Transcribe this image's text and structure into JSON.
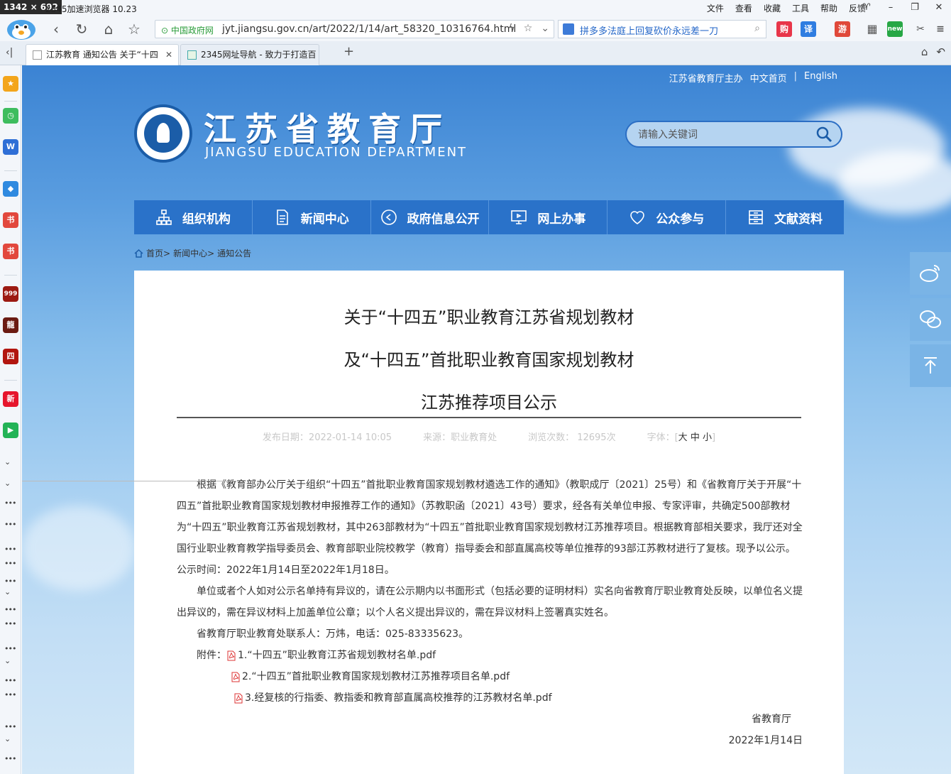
{
  "browser": {
    "dims_badge": "1342 × 692",
    "window_title": "2345加速浏览器 10.23",
    "menu": [
      "文件",
      "查看",
      "收藏",
      "工具",
      "帮助",
      "反馈"
    ],
    "secure_label": "中国政府网",
    "url": "jyt.jiangsu.gov.cn/art/2022/1/14/art_58320_10316764.html",
    "search_text": "拼多多法庭上回复砍价永远差一刀",
    "tool_icons": [
      {
        "label": "购",
        "color": "#e8364a"
      },
      {
        "label": "译",
        "color": "#2f7de1"
      },
      {
        "label": "游",
        "color": "#e0493a"
      },
      {
        "label": "new",
        "color": "#27a745"
      }
    ],
    "tabs": [
      {
        "label": "江苏教育 通知公告 关于“十四",
        "active": true
      },
      {
        "label": "2345网址导航 - 致力于打造百",
        "active": false
      }
    ],
    "sidebar_icons": [
      {
        "icon": "star-icon",
        "color": "#f3a51b",
        "label": "★"
      },
      {
        "icon": "clock-icon",
        "color": "#3ebd5e",
        "label": "◷"
      },
      {
        "icon": "word-icon",
        "color": "#2f6fd6",
        "label": "W"
      },
      {
        "icon": "app-icon",
        "color": "#2f8ae0",
        "label": "◆"
      },
      {
        "icon": "book-icon",
        "color": "#e2483d",
        "label": "书"
      },
      {
        "icon": "book2-icon",
        "color": "#e2483d",
        "label": "书"
      },
      {
        "icon": "game-icon",
        "color": "#9c1a12",
        "label": "999"
      },
      {
        "icon": "dragon-icon",
        "color": "#6b1b12",
        "label": "龍"
      },
      {
        "icon": "legend-icon",
        "color": "#b2160f",
        "label": "四"
      },
      {
        "icon": "sina-icon",
        "color": "#e6162d",
        "label": "新"
      },
      {
        "icon": "video-icon",
        "color": "#23b356",
        "label": "▶"
      }
    ]
  },
  "site": {
    "top_links": [
      "江苏省教育厅主办",
      "中文首页",
      "English"
    ],
    "name_cn": "江苏省教育厅",
    "name_en": "JIANGSU EDUCATION DEPARTMENT",
    "search_placeholder": "请输入关键词",
    "nav": [
      {
        "label": "组织机构",
        "icon": "org-chart-icon"
      },
      {
        "label": "新闻中心",
        "icon": "document-icon"
      },
      {
        "label": "政府信息公开",
        "icon": "play-circle-icon"
      },
      {
        "label": "网上办事",
        "icon": "monitor-icon"
      },
      {
        "label": "公众参与",
        "icon": "heart-icon"
      },
      {
        "label": "文献资料",
        "icon": "archive-icon"
      }
    ],
    "breadcrumb": [
      "首页>",
      "新闻中心>",
      "通知公告"
    ]
  },
  "article": {
    "title_lines": [
      "关于“十四五”职业教育江苏省规划教材",
      "及“十四五”首批职业教育国家规划教材",
      "江苏推荐项目公示"
    ],
    "meta": {
      "publish": "发布日期：2022-01-14 10:05",
      "source": "来源：职业教育处",
      "views": "浏览次数： 12695次",
      "font_label": "字体：[",
      "font_large": "大",
      "font_medium": "中",
      "font_small": "小",
      "font_end": "]"
    },
    "paragraphs": [
      "根据《教育部办公厅关于组织“十四五”首批职业教育国家规划教材遴选工作的通知》（教职成厅〔2021〕25号）和《省教育厅关于开展“十四五”首批职业教育国家规划教材申报推荐工作的通知》（苏教职函〔2021〕43号）要求，经各有关单位申报、专家评审，共确定500部教材为“十四五”职业教育江苏省规划教材，其中263部教材为“十四五”首批职业教育国家规划教材江苏推荐项目。根据教育部相关要求，我厅还对全国行业职业教育教学指导委员会、教育部职业院校教学（教育）指导委会和部直属高校等单位推荐的93部江苏教材进行了复核。现予以公示。公示时间：2022年1月14日至2022年1月18日。",
      "单位或者个人如对公示名单持有异议的，请在公示期内以书面形式（包括必要的证明材料）实名向省教育厅职业教育处反映，以单位名义提出异议的，需在异议材料上加盖单位公章；以个人名义提出异议的，需在异议材料上签署真实姓名。",
      "省教育厅职业教育处联系人：万炜，电话：025-83335623。"
    ],
    "attach_label": "附件：",
    "attachments": [
      "1.“十四五”职业教育江苏省规划教材名单.pdf",
      "2.“十四五”首批职业教育国家规划教材江苏推荐项目名单.pdf",
      "3.经复核的行指委、教指委和教育部直属高校推荐的江苏教材名单.pdf"
    ],
    "signature": "省教育厅",
    "date": "2022年1月14日"
  }
}
